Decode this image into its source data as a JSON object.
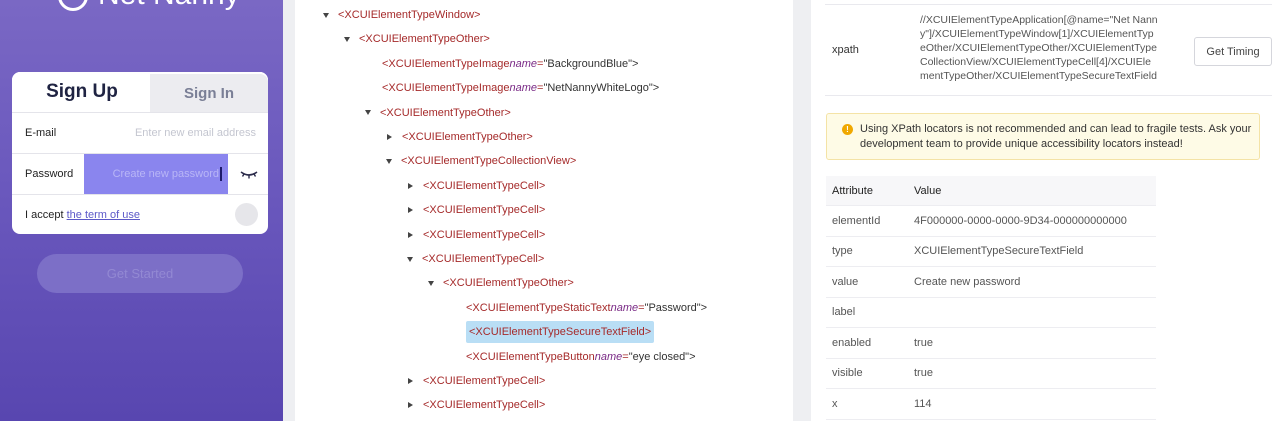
{
  "phone": {
    "logo": "Net Nanny",
    "tab_signup": "Sign Up",
    "tab_signin": "Sign In",
    "email_label": "E-mail",
    "email_placeholder": "Enter new email address",
    "password_label": "Password",
    "password_placeholder": "Create new password",
    "accept_text": "I accept",
    "terms_link": "the term of use",
    "get_started": "Get Started"
  },
  "tree": {
    "nodes": [
      {
        "tag": "<XCUIElementTypeWindow>",
        "toggle": "down"
      },
      {
        "tag": "<XCUIElementTypeOther>",
        "toggle": "down"
      },
      {
        "tag": "<XCUIElementTypeImage",
        "attr": "name",
        "val": "\"BackgroundBlue\">",
        "toggle": "none"
      },
      {
        "tag": "<XCUIElementTypeImage",
        "attr": "name",
        "val": "\"NetNannyWhiteLogo\">",
        "toggle": "none"
      },
      {
        "tag": "<XCUIElementTypeOther>",
        "toggle": "down"
      },
      {
        "tag": "<XCUIElementTypeOther>",
        "toggle": "right"
      },
      {
        "tag": "<XCUIElementTypeCollectionView>",
        "toggle": "down"
      },
      {
        "tag": "<XCUIElementTypeCell>",
        "toggle": "right"
      },
      {
        "tag": "<XCUIElementTypeCell>",
        "toggle": "right"
      },
      {
        "tag": "<XCUIElementTypeCell>",
        "toggle": "right"
      },
      {
        "tag": "<XCUIElementTypeCell>",
        "toggle": "down"
      },
      {
        "tag": "<XCUIElementTypeOther>",
        "toggle": "down"
      },
      {
        "tag": "<XCUIElementTypeStaticText",
        "attr": "name",
        "val": "\"Password\">",
        "toggle": "none"
      },
      {
        "tag": "<XCUIElementTypeSecureTextField>",
        "toggle": "none",
        "selected": true
      },
      {
        "tag": "<XCUIElementTypeButton",
        "attr": "name",
        "val": "\"eye closed\">",
        "toggle": "none"
      },
      {
        "tag": "<XCUIElementTypeCell>",
        "toggle": "right"
      },
      {
        "tag": "<XCUIElementTypeCell>",
        "toggle": "right"
      }
    ]
  },
  "inspector": {
    "xpath_label": "xpath",
    "xpath_value": "//XCUIElementTypeApplication[@name=\"Net Nanny\"]/XCUIElementTypeWindow[1]/XCUIElementTypeOther/XCUIElementTypeOther/XCUIElementTypeCollectionView/XCUIElementTypeCell[4]/XCUIElementTypeOther/XCUIElementTypeSecureTextField",
    "get_timing": "Get Timing",
    "warning": "Using XPath locators is not recommended and can lead to fragile tests. Ask your development team to provide unique accessibility locators instead!",
    "col_attribute": "Attribute",
    "col_value": "Value",
    "attributes": [
      {
        "name": "elementId",
        "value": "4F000000-0000-0000-9D34-000000000000"
      },
      {
        "name": "type",
        "value": "XCUIElementTypeSecureTextField"
      },
      {
        "name": "value",
        "value": "Create new password"
      },
      {
        "name": "label",
        "value": ""
      },
      {
        "name": "enabled",
        "value": "true"
      },
      {
        "name": "visible",
        "value": "true"
      },
      {
        "name": "x",
        "value": "114"
      }
    ]
  }
}
